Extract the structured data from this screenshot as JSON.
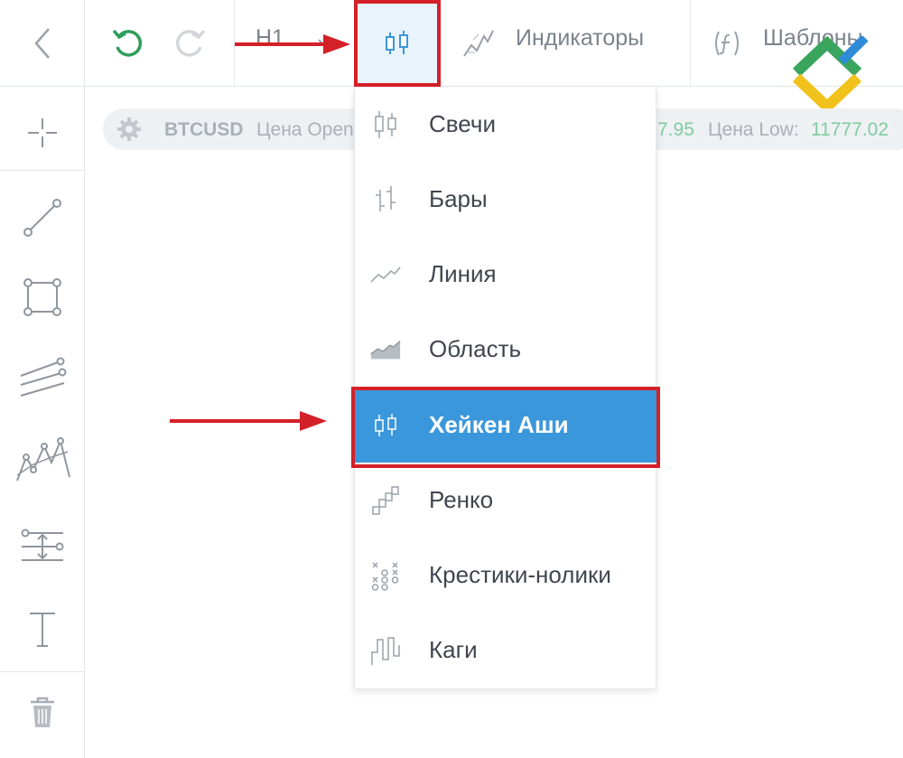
{
  "toolbar": {
    "back_icon": "chevron-left-icon",
    "undo_icon": "undo-icon",
    "redo_icon": "redo-icon",
    "timeframe": "H1",
    "chart_type_icon": "candles-icon",
    "indicators_label": "Индикаторы",
    "templates_label": "Шаблоны"
  },
  "info_bar": {
    "symbol": "BTCUSD",
    "open_label": "Цена Open",
    "high_value_partial": "7.95",
    "low_label": "Цена Low:",
    "low_value": "11777.02"
  },
  "chart_types": [
    {
      "label": "Свечи",
      "icon": "candles-icon"
    },
    {
      "label": "Бары",
      "icon": "bars-icon"
    },
    {
      "label": "Линия",
      "icon": "line-chart-icon"
    },
    {
      "label": "Область",
      "icon": "area-chart-icon"
    },
    {
      "label": "Хейкен Аши",
      "icon": "heikin-ashi-icon",
      "selected": true
    },
    {
      "label": "Ренко",
      "icon": "renko-icon"
    },
    {
      "label": "Крестики-нолики",
      "icon": "point-figure-icon"
    },
    {
      "label": "Каги",
      "icon": "kagi-icon"
    }
  ],
  "left_tools": [
    "crosshair-icon",
    "trend-line-icon",
    "rectangle-icon",
    "parallel-channel-icon",
    "pattern-icon",
    "measure-icon",
    "text-icon",
    "trash-icon"
  ],
  "colors": {
    "selection": "#3b97db",
    "highlight_border": "#d42027",
    "positive": "#3fb27f",
    "undo": "#2e9e5b"
  }
}
